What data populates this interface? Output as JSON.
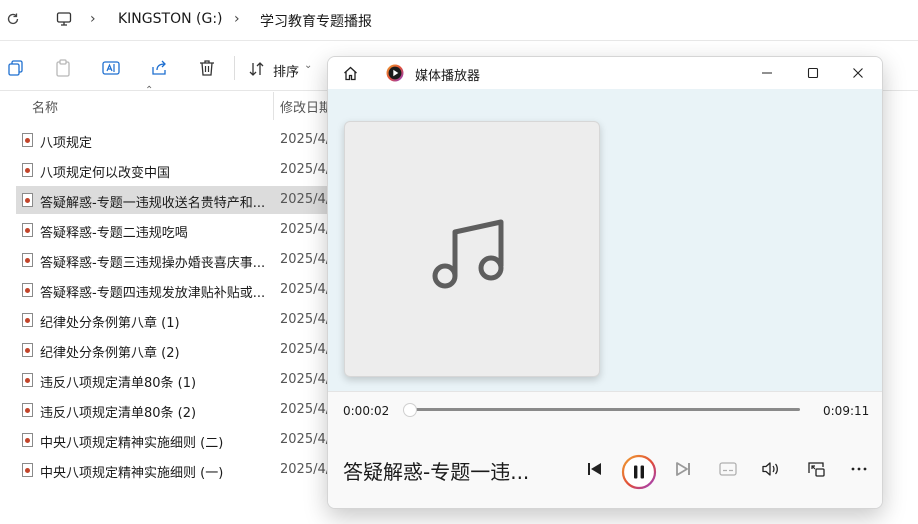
{
  "explorer": {
    "breadcrumb": [
      "KINGSTON (G:)",
      "学习教育专题播报"
    ],
    "toolbar": {
      "sort_label": "排序"
    },
    "columns": {
      "name": "名称",
      "modified": "修改日期"
    },
    "files": [
      {
        "name": "八项规定",
        "date": "2025/4/"
      },
      {
        "name": "八项规定何以改变中国",
        "date": "2025/4/"
      },
      {
        "name": "答疑解惑-专题一违规收送名贵特产和...",
        "date": "2025/4/",
        "selected": true
      },
      {
        "name": "答疑释惑-专题二违规吃喝",
        "date": "2025/4/"
      },
      {
        "name": "答疑释惑-专题三违规操办婚丧喜庆事...",
        "date": "2025/4/"
      },
      {
        "name": "答疑释惑-专题四违规发放津贴补贴或...",
        "date": "2025/4/"
      },
      {
        "name": "纪律处分条例第八章 (1)",
        "date": "2025/4/"
      },
      {
        "name": "纪律处分条例第八章 (2)",
        "date": "2025/4/"
      },
      {
        "name": "违反八项规定清单80条 (1)",
        "date": "2025/4/"
      },
      {
        "name": "违反八项规定清单80条 (2)",
        "date": "2025/4/"
      },
      {
        "name": "中央八项规定精神实施细则 (二)",
        "date": "2025/4/"
      },
      {
        "name": "中央八项规定精神实施细则 (一)",
        "date": "2025/4/"
      }
    ]
  },
  "player": {
    "title": "媒体播放器",
    "elapsed": "0:00:02",
    "duration": "0:09:11",
    "progress": 0.004,
    "now_playing": "答疑解惑-专题一违...",
    "accent": "#c8421b"
  }
}
